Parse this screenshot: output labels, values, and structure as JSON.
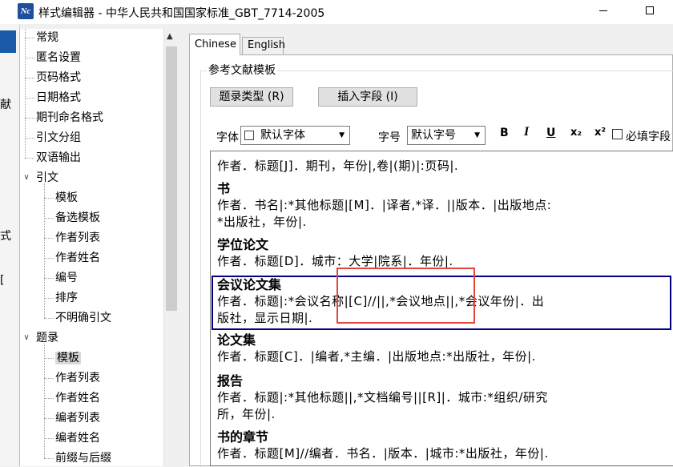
{
  "window": {
    "title": "样式编辑器 - 中华人民共和国国家标准_GBT_7714-2005",
    "icon_text": "Nc"
  },
  "background_chars": [
    "献",
    "式",
    "["
  ],
  "tree": {
    "items": [
      {
        "label": "常规",
        "level": 1
      },
      {
        "label": "匿名设置",
        "level": 1
      },
      {
        "label": "页码格式",
        "level": 1
      },
      {
        "label": "日期格式",
        "level": 1
      },
      {
        "label": "期刊命名格式",
        "level": 1
      },
      {
        "label": "引文分组",
        "level": 1
      },
      {
        "label": "双语输出",
        "level": 1
      },
      {
        "label": "引文",
        "level": 0
      },
      {
        "label": "模板",
        "level": 2
      },
      {
        "label": "备选模板",
        "level": 2
      },
      {
        "label": "作者列表",
        "level": 2
      },
      {
        "label": "作者姓名",
        "level": 2
      },
      {
        "label": "编号",
        "level": 2
      },
      {
        "label": "排序",
        "level": 2
      },
      {
        "label": "不明确引文",
        "level": 2
      },
      {
        "label": "题录",
        "level": 0
      },
      {
        "label": "模板",
        "level": 2,
        "selected": true
      },
      {
        "label": "作者列表",
        "level": 2
      },
      {
        "label": "作者姓名",
        "level": 2
      },
      {
        "label": "编者列表",
        "level": 2
      },
      {
        "label": "编者姓名",
        "level": 2
      },
      {
        "label": "前缀与后缀",
        "level": 2
      }
    ]
  },
  "tabs": [
    {
      "label": "Chinese",
      "active": true
    },
    {
      "label": "English",
      "active": false
    }
  ],
  "group_title": "参考文献模板",
  "buttons": {
    "ref_type": "题录类型 (R)",
    "insert_field": "插入字段 (I)"
  },
  "toolbar": {
    "font_label": "字体",
    "font_value": "默认字体",
    "size_label": "字号",
    "size_value": "默认字号",
    "bold": "B",
    "italic": "I",
    "underline": "U",
    "subscript": "x₂",
    "superscript": "x²",
    "required_label": "必填字段"
  },
  "editor": {
    "entries": [
      {
        "title": "",
        "lines": [
          "作者．标题[J]．期刊，年份|,卷|(期)|:页码|."
        ]
      },
      {
        "title": "书",
        "lines": [
          "作者．书名|:*其他标题|[M]．|译者,*译．||版本．|出版地点:",
          "*出版社，年份|."
        ]
      },
      {
        "title": "学位论文",
        "lines": [
          "作者．标题[D]．城市：大学|院系|．年份|."
        ]
      },
      {
        "title": "会议论文集",
        "lines": [
          "作者．标题|:*会议名称|[C]//||,*会议地点||,*会议年份|．出",
          "版社，显示日期|."
        ]
      },
      {
        "title": "论文集",
        "lines": [
          "作者．标题[C]．|编者,*主编．|出版地点:*出版社，年份|."
        ]
      },
      {
        "title": "报告",
        "lines": [
          "作者．标题|:*其他标题||,*文档编号||[R]|．城市:*组织/研究",
          "所，年份|."
        ]
      },
      {
        "title": "书的章节",
        "lines": [
          "作者．标题[M]//编者．书名．|版本．|城市:*出版社，年份|."
        ]
      }
    ]
  }
}
